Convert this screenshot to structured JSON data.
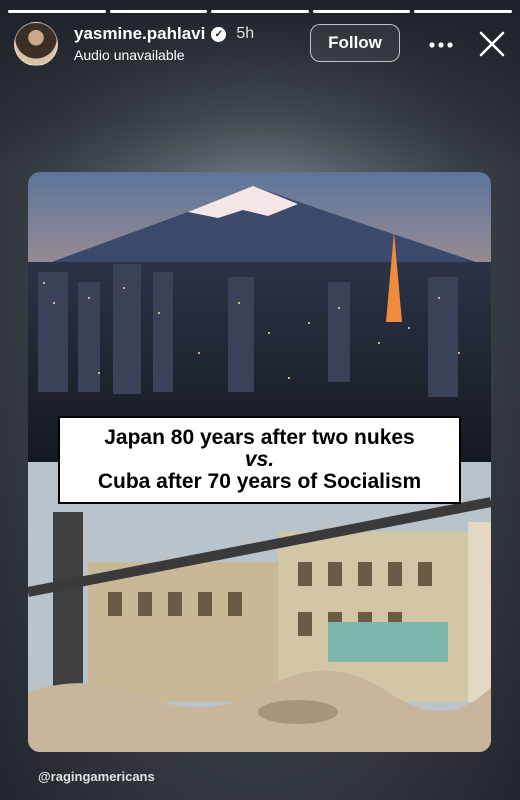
{
  "story": {
    "progress_segments": [
      1,
      1,
      1,
      1,
      1
    ],
    "username": "yasmine.pahlavi",
    "time_ago": "5h",
    "audio_status": "Audio unavailable",
    "follow_label": "Follow"
  },
  "post": {
    "caption": {
      "line1": "Japan 80 years after two nukes",
      "line2": "vs.",
      "line3": "Cuba after 70 years of Socialism"
    },
    "credit": "@ragingamericans"
  },
  "icons": {
    "verified": "verified-badge-icon",
    "more": "more-options-icon",
    "close": "close-icon"
  }
}
